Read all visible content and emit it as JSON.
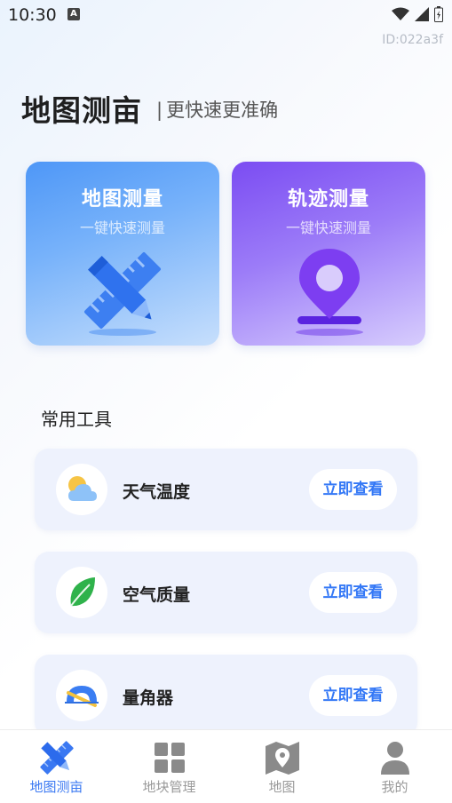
{
  "status_bar": {
    "time": "10:30",
    "notification_glyph": "A"
  },
  "device_id": "ID:022a3f",
  "header": {
    "title": "地图测亩",
    "subtitle_separator": "|",
    "subtitle": "更快速更准确"
  },
  "cards": [
    {
      "title": "地图测量",
      "subtitle": "一键快速测量",
      "icon": "ruler-pencil-icon"
    },
    {
      "title": "轨迹测量",
      "subtitle": "一键快速测量",
      "icon": "location-pin-icon"
    }
  ],
  "tools_section": {
    "title": "常用工具",
    "items": [
      {
        "name": "天气温度",
        "button": "立即查看",
        "icon": "weather-icon"
      },
      {
        "name": "空气质量",
        "button": "立即查看",
        "icon": "leaf-icon"
      },
      {
        "name": "量角器",
        "button": "立即查看",
        "icon": "protractor-icon"
      }
    ]
  },
  "bottom_nav": {
    "active_color": "#3a78f2",
    "items": [
      {
        "label": "地图测亩",
        "icon": "ruler-pencil-icon",
        "active": true
      },
      {
        "label": "地块管理",
        "icon": "grid-icon",
        "active": false
      },
      {
        "label": "地图",
        "icon": "map-icon",
        "active": false
      },
      {
        "label": "我的",
        "icon": "person-icon",
        "active": false
      }
    ]
  }
}
